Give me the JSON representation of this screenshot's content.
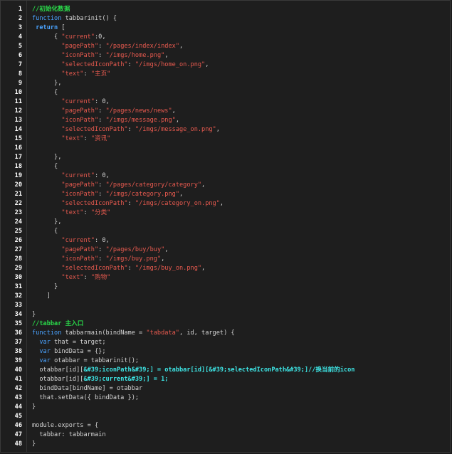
{
  "colors": {
    "background": "#1e1e1e",
    "line_number": "#ffffff",
    "comment": "#2ad94a",
    "keyword": "#4aa3ff",
    "string": "#e85a4f",
    "highlight": "#3ee6e6",
    "plain": "#d4d4d4"
  },
  "code_lines": [
    {
      "n": "1",
      "indent": "",
      "tokens": [
        {
          "t": "//初始化数据",
          "c": "comment"
        }
      ]
    },
    {
      "n": "2",
      "indent": "",
      "tokens": [
        {
          "t": "function",
          "c": "kw"
        },
        {
          "t": " tabbarinit() {",
          "c": "plain"
        }
      ]
    },
    {
      "n": "3",
      "indent": " ",
      "tokens": [
        {
          "t": "return",
          "c": "kwb"
        },
        {
          "t": " [",
          "c": "plain"
        }
      ]
    },
    {
      "n": "4",
      "indent": "      ",
      "tokens": [
        {
          "t": "{ ",
          "c": "plain"
        },
        {
          "t": "\"current\"",
          "c": "str"
        },
        {
          "t": ":0,",
          "c": "plain"
        }
      ]
    },
    {
      "n": "5",
      "indent": "        ",
      "tokens": [
        {
          "t": "\"pagePath\"",
          "c": "str"
        },
        {
          "t": ": ",
          "c": "plain"
        },
        {
          "t": "\"/pages/index/index\"",
          "c": "str"
        },
        {
          "t": ",",
          "c": "plain"
        }
      ]
    },
    {
      "n": "6",
      "indent": "        ",
      "tokens": [
        {
          "t": "\"iconPath\"",
          "c": "str"
        },
        {
          "t": ": ",
          "c": "plain"
        },
        {
          "t": "\"/imgs/home.png\"",
          "c": "str"
        },
        {
          "t": ",",
          "c": "plain"
        }
      ]
    },
    {
      "n": "7",
      "indent": "        ",
      "tokens": [
        {
          "t": "\"selectedIconPath\"",
          "c": "str"
        },
        {
          "t": ": ",
          "c": "plain"
        },
        {
          "t": "\"/imgs/home_on.png\"",
          "c": "str"
        },
        {
          "t": ",",
          "c": "plain"
        }
      ]
    },
    {
      "n": "8",
      "indent": "        ",
      "tokens": [
        {
          "t": "\"text\"",
          "c": "str"
        },
        {
          "t": ": ",
          "c": "plain"
        },
        {
          "t": "\"主页\"",
          "c": "str"
        }
      ]
    },
    {
      "n": "9",
      "indent": "      ",
      "tokens": [
        {
          "t": "},",
          "c": "plain"
        }
      ]
    },
    {
      "n": "10",
      "indent": "      ",
      "tokens": [
        {
          "t": "{",
          "c": "plain"
        }
      ]
    },
    {
      "n": "11",
      "indent": "        ",
      "tokens": [
        {
          "t": "\"current\"",
          "c": "str"
        },
        {
          "t": ": 0,",
          "c": "plain"
        }
      ]
    },
    {
      "n": "12",
      "indent": "        ",
      "tokens": [
        {
          "t": "\"pagePath\"",
          "c": "str"
        },
        {
          "t": ": ",
          "c": "plain"
        },
        {
          "t": "\"/pages/news/news\"",
          "c": "str"
        },
        {
          "t": ",",
          "c": "plain"
        }
      ]
    },
    {
      "n": "13",
      "indent": "        ",
      "tokens": [
        {
          "t": "\"iconPath\"",
          "c": "str"
        },
        {
          "t": ": ",
          "c": "plain"
        },
        {
          "t": "\"/imgs/message.png\"",
          "c": "str"
        },
        {
          "t": ",",
          "c": "plain"
        }
      ]
    },
    {
      "n": "14",
      "indent": "        ",
      "tokens": [
        {
          "t": "\"selectedIconPath\"",
          "c": "str"
        },
        {
          "t": ": ",
          "c": "plain"
        },
        {
          "t": "\"/imgs/message_on.png\"",
          "c": "str"
        },
        {
          "t": ",",
          "c": "plain"
        }
      ]
    },
    {
      "n": "15",
      "indent": "        ",
      "tokens": [
        {
          "t": "\"text\"",
          "c": "str"
        },
        {
          "t": ": ",
          "c": "plain"
        },
        {
          "t": "\"资讯\"",
          "c": "str"
        }
      ]
    },
    {
      "n": "16",
      "indent": "",
      "tokens": []
    },
    {
      "n": "17",
      "indent": "      ",
      "tokens": [
        {
          "t": "},",
          "c": "plain"
        }
      ]
    },
    {
      "n": "18",
      "indent": "      ",
      "tokens": [
        {
          "t": "{",
          "c": "plain"
        }
      ]
    },
    {
      "n": "19",
      "indent": "        ",
      "tokens": [
        {
          "t": "\"current\"",
          "c": "str"
        },
        {
          "t": ": 0,",
          "c": "plain"
        }
      ]
    },
    {
      "n": "20",
      "indent": "        ",
      "tokens": [
        {
          "t": "\"pagePath\"",
          "c": "str"
        },
        {
          "t": ": ",
          "c": "plain"
        },
        {
          "t": "\"/pages/category/category\"",
          "c": "str"
        },
        {
          "t": ",",
          "c": "plain"
        }
      ]
    },
    {
      "n": "21",
      "indent": "        ",
      "tokens": [
        {
          "t": "\"iconPath\"",
          "c": "str"
        },
        {
          "t": ": ",
          "c": "plain"
        },
        {
          "t": "\"/imgs/category.png\"",
          "c": "str"
        },
        {
          "t": ",",
          "c": "plain"
        }
      ]
    },
    {
      "n": "22",
      "indent": "        ",
      "tokens": [
        {
          "t": "\"selectedIconPath\"",
          "c": "str"
        },
        {
          "t": ": ",
          "c": "plain"
        },
        {
          "t": "\"/imgs/category_on.png\"",
          "c": "str"
        },
        {
          "t": ",",
          "c": "plain"
        }
      ]
    },
    {
      "n": "23",
      "indent": "        ",
      "tokens": [
        {
          "t": "\"text\"",
          "c": "str"
        },
        {
          "t": ": ",
          "c": "plain"
        },
        {
          "t": "\"分类\"",
          "c": "str"
        }
      ]
    },
    {
      "n": "24",
      "indent": "      ",
      "tokens": [
        {
          "t": "},",
          "c": "plain"
        }
      ]
    },
    {
      "n": "25",
      "indent": "      ",
      "tokens": [
        {
          "t": "{",
          "c": "plain"
        }
      ]
    },
    {
      "n": "26",
      "indent": "        ",
      "tokens": [
        {
          "t": "\"current\"",
          "c": "str"
        },
        {
          "t": ": 0,",
          "c": "plain"
        }
      ]
    },
    {
      "n": "27",
      "indent": "        ",
      "tokens": [
        {
          "t": "\"pagePath\"",
          "c": "str"
        },
        {
          "t": ": ",
          "c": "plain"
        },
        {
          "t": "\"/pages/buy/buy\"",
          "c": "str"
        },
        {
          "t": ",",
          "c": "plain"
        }
      ]
    },
    {
      "n": "28",
      "indent": "        ",
      "tokens": [
        {
          "t": "\"iconPath\"",
          "c": "str"
        },
        {
          "t": ": ",
          "c": "plain"
        },
        {
          "t": "\"/imgs/buy.png\"",
          "c": "str"
        },
        {
          "t": ",",
          "c": "plain"
        }
      ]
    },
    {
      "n": "29",
      "indent": "        ",
      "tokens": [
        {
          "t": "\"selectedIconPath\"",
          "c": "str"
        },
        {
          "t": ": ",
          "c": "plain"
        },
        {
          "t": "\"/imgs/buy_on.png\"",
          "c": "str"
        },
        {
          "t": ",",
          "c": "plain"
        }
      ]
    },
    {
      "n": "30",
      "indent": "        ",
      "tokens": [
        {
          "t": "\"text\"",
          "c": "str"
        },
        {
          "t": ": ",
          "c": "plain"
        },
        {
          "t": "\"购物\"",
          "c": "str"
        }
      ]
    },
    {
      "n": "31",
      "indent": "      ",
      "tokens": [
        {
          "t": "}",
          "c": "plain"
        }
      ]
    },
    {
      "n": "32",
      "indent": "    ",
      "tokens": [
        {
          "t": "]",
          "c": "plain"
        }
      ]
    },
    {
      "n": "33",
      "indent": "",
      "tokens": []
    },
    {
      "n": "34",
      "indent": "",
      "tokens": [
        {
          "t": "}",
          "c": "plain"
        }
      ]
    },
    {
      "n": "35",
      "indent": "",
      "tokens": [
        {
          "t": "//tabbar 主入口",
          "c": "comment"
        }
      ]
    },
    {
      "n": "36",
      "indent": "",
      "tokens": [
        {
          "t": "function",
          "c": "kw"
        },
        {
          "t": " tabbarmain(bindName = ",
          "c": "plain"
        },
        {
          "t": "\"tabdata\"",
          "c": "str"
        },
        {
          "t": ", id, target) {",
          "c": "plain"
        }
      ]
    },
    {
      "n": "37",
      "indent": "  ",
      "tokens": [
        {
          "t": "var",
          "c": "kw"
        },
        {
          "t": " that = target;",
          "c": "plain"
        }
      ]
    },
    {
      "n": "38",
      "indent": "  ",
      "tokens": [
        {
          "t": "var",
          "c": "kw"
        },
        {
          "t": " bindData = {};",
          "c": "plain"
        }
      ]
    },
    {
      "n": "39",
      "indent": "  ",
      "tokens": [
        {
          "t": "var",
          "c": "kw"
        },
        {
          "t": " otabbar = tabbarinit();",
          "c": "plain"
        }
      ]
    },
    {
      "n": "40",
      "indent": "  ",
      "tokens": [
        {
          "t": "otabbar[id][",
          "c": "plain"
        },
        {
          "t": "&#39;iconPath&#39;] = otabbar[id][&#39;selectedIconPath&#39;]//换当前的icon",
          "c": "cyan"
        }
      ]
    },
    {
      "n": "41",
      "indent": "  ",
      "tokens": [
        {
          "t": "otabbar[id][",
          "c": "plain"
        },
        {
          "t": "&#39;current&#39;] = 1;",
          "c": "cyan"
        }
      ]
    },
    {
      "n": "42",
      "indent": "  ",
      "tokens": [
        {
          "t": "bindData[bindName] = otabbar",
          "c": "plain"
        }
      ]
    },
    {
      "n": "43",
      "indent": "  ",
      "tokens": [
        {
          "t": "that.setData({ bindData });",
          "c": "plain"
        }
      ]
    },
    {
      "n": "44",
      "indent": "",
      "tokens": [
        {
          "t": "}",
          "c": "plain"
        }
      ]
    },
    {
      "n": "45",
      "indent": "",
      "tokens": []
    },
    {
      "n": "46",
      "indent": "",
      "tokens": [
        {
          "t": "module.exports = {",
          "c": "plain"
        }
      ]
    },
    {
      "n": "47",
      "indent": "  ",
      "tokens": [
        {
          "t": "tabbar: tabbarmain",
          "c": "plain"
        }
      ]
    },
    {
      "n": "48",
      "indent": "",
      "tokens": [
        {
          "t": "}",
          "c": "plain"
        }
      ]
    }
  ]
}
